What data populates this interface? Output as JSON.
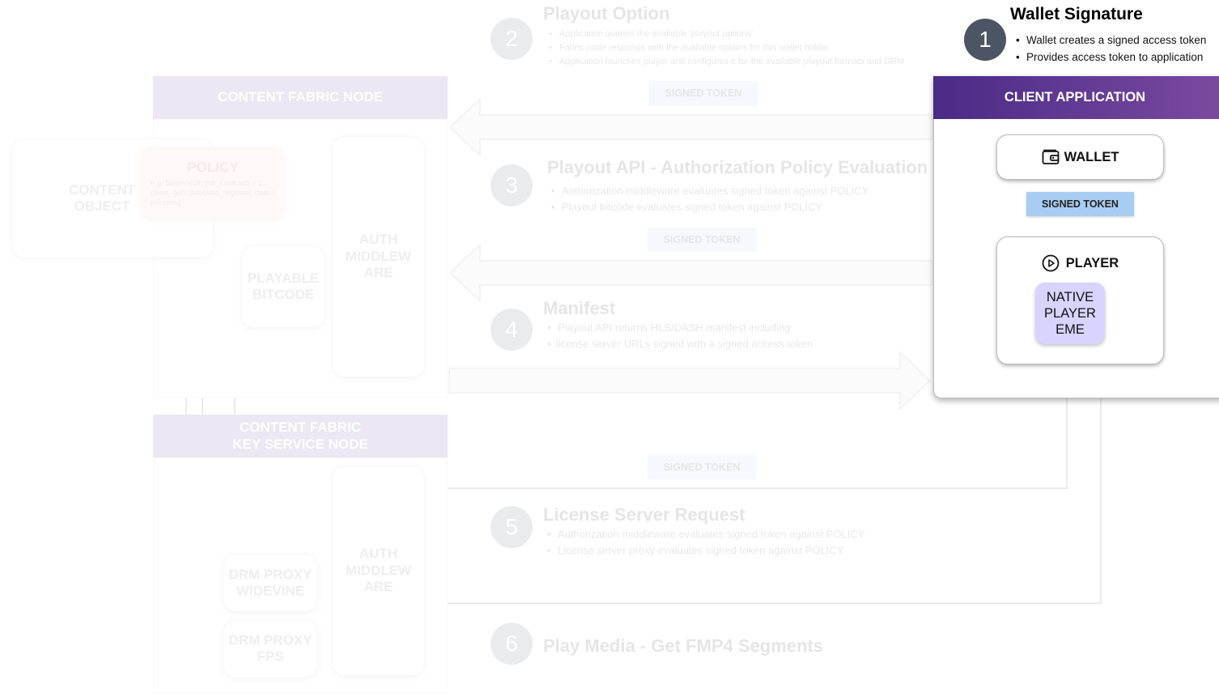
{
  "steps": {
    "s1": {
      "number": "1",
      "title": "Wallet Signature",
      "bullets": [
        "Wallet creates a signed access token",
        "Provides access token to application"
      ]
    },
    "s2": {
      "number": "2",
      "title": "Playout Option",
      "bullets": [
        "Application queries the available 'playout options'",
        "Fabric node responds with the available options for this wallet holder",
        "Application launches player and configures it for the available playout formats and DRM"
      ]
    },
    "s3": {
      "number": "3",
      "title": "Playout API - Authorization Policy Evaluation",
      "bullets": [
        "Authorization middleware evaluates signed token against POLICY",
        "Playout bitcode evaluates signed token against POLICY"
      ]
    },
    "s4": {
      "number": "4",
      "title": "Manifest",
      "bullets": [
        "Playout API returns HLS/DASH manifest including",
        "license server URLs signed with a signed access token"
      ]
    },
    "s5": {
      "number": "5",
      "title": "License Server Request",
      "bullets": [
        "Authorization middleware evaluates signed token against POLICY",
        "License server proxy evaluates signed token against POLICY"
      ]
    },
    "s6": {
      "number": "6",
      "title": "Play Media - Get FMP4 Segments"
    }
  },
  "tokens": {
    "top": "SIGNED TOKEN",
    "mid": "SIGNED TOKEN",
    "low": "SIGNED TOKEN",
    "client": "SIGNED TOKEN"
  },
  "fabric_node": {
    "header": "CONTENT FABRIC NODE",
    "content_object": "CONTENT OBJECT",
    "policy_title": "POLICY",
    "policy_text": "e.g. balanceOf=[nft_contract] > 1, client_geo=[blocked_regions], date=[window]",
    "auth_middleware": "AUTH MIDDLEW ARE",
    "playable_bitcode": "PLAYABLE BITCODE"
  },
  "key_node": {
    "header": "CONTENT FABRIC KEY SERVICE NODE",
    "auth_middleware": "AUTH MIDDLEW ARE",
    "drm_widevine": "DRM PROXY WIDEVINE",
    "drm_fps": "DRM PROXY FPS"
  },
  "client": {
    "header": "CLIENT APPLICATION",
    "wallet_label": "WALLET",
    "player_label": "PLAYER",
    "native_player": "NATIVE PLAYER EME"
  },
  "colors": {
    "fabric_purple": "#5c2d91",
    "client_gradient_start": "#4a2b86",
    "client_gradient_end": "#7b4aa0",
    "token_blue": "#a9cdf2",
    "native_player_lavender": "#d8d4ff",
    "step_circle": "#4b5563"
  },
  "icons": {
    "wallet": "wallet-icon",
    "player": "play-circle-icon",
    "arrows": "arrow-icon"
  }
}
